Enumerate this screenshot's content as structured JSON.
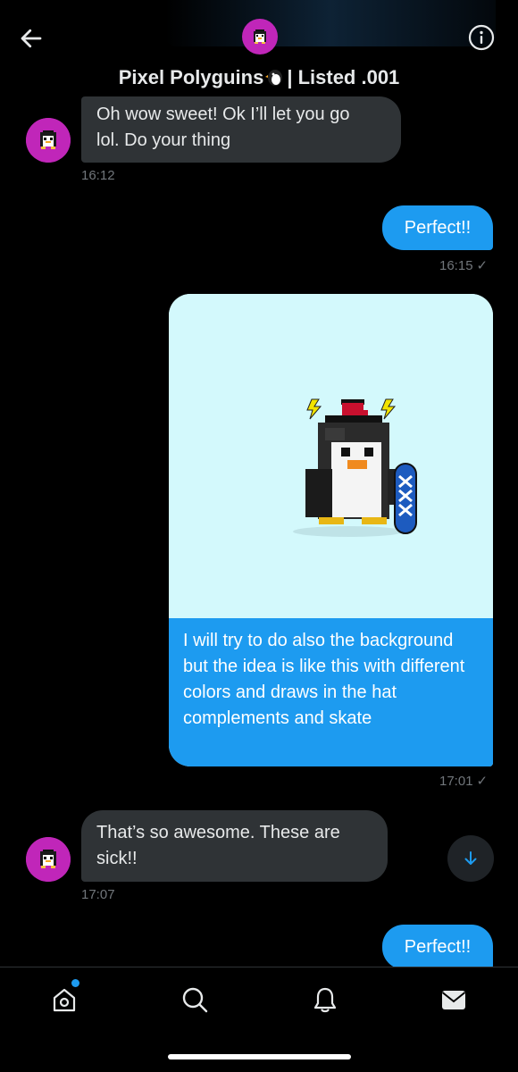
{
  "header": {
    "title": "Pixel Polyguins",
    "title_suffix": "| Listed .001",
    "back_icon": "arrow-left-icon",
    "info_icon": "info-icon"
  },
  "messages": [
    {
      "from": "them",
      "text_line1": "Oh wow sweet! Ok I’ll let you go",
      "text_line2": "lol. Do your thing",
      "time": "16:12"
    },
    {
      "from": "me",
      "text": "Perfect!!",
      "time": "16:15",
      "status": "✓"
    },
    {
      "from": "me",
      "caption": "I will try to do also the background but the idea is like this with different colors and draws in the hat complements and skate",
      "time": "17:01",
      "status": "✓"
    },
    {
      "from": "them",
      "text_line1": "That’s so awesome. These are",
      "text_line2": "sick!!",
      "time": "17:07"
    },
    {
      "from": "me",
      "text": "Perfect!!"
    }
  ],
  "tabs": [
    {
      "name": "home",
      "icon": "home-icon"
    },
    {
      "name": "search",
      "icon": "search-icon"
    },
    {
      "name": "notifications",
      "icon": "bell-icon"
    },
    {
      "name": "messages",
      "icon": "mail-icon"
    }
  ],
  "colors": {
    "accent": "#1d9bf0",
    "avatar_bg": "#c026b9",
    "incoming_bubble": "#2f3336",
    "image_bg": "#d3f9fc"
  }
}
